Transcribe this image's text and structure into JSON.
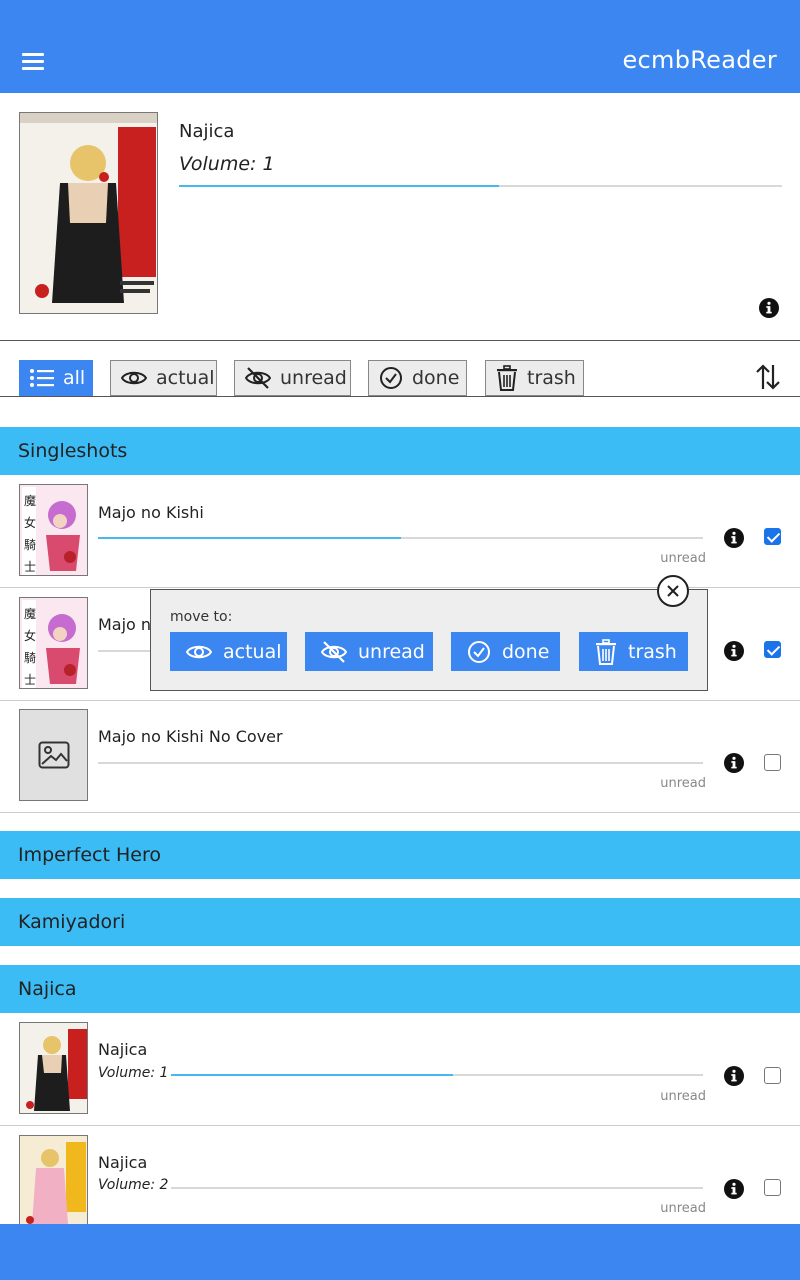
{
  "app": {
    "title": "ecmbReader"
  },
  "current_book": {
    "title": "Najica",
    "volume": "Volume: 1",
    "progress": 0.53
  },
  "filters": [
    {
      "label": "all",
      "icon": "list-icon",
      "active": true
    },
    {
      "label": "actual",
      "icon": "eye-icon",
      "active": false
    },
    {
      "label": "unread",
      "icon": "eye-slash-icon",
      "active": false
    },
    {
      "label": "done",
      "icon": "check-circle-icon",
      "active": false
    },
    {
      "label": "trash",
      "icon": "trash-icon",
      "active": false
    }
  ],
  "groups": [
    {
      "name": "Singleshots"
    },
    {
      "name": "Imperfect Hero"
    },
    {
      "name": "Kamiyadori"
    },
    {
      "name": "Najica"
    }
  ],
  "items": [
    {
      "title": "Majo no Kishi",
      "status": "unread",
      "progress": 0.5,
      "checked": true
    },
    {
      "title": "Majo no Kishi",
      "status": "unread",
      "progress": 0.0,
      "checked": true
    },
    {
      "title": "Majo no Kishi No Cover",
      "status": "unread",
      "progress": 0.0,
      "checked": false
    },
    {
      "title": "Najica",
      "volume": "Volume: 1",
      "status": "unread",
      "progress": 0.53,
      "checked": false
    },
    {
      "title": "Najica",
      "volume": "Volume: 2",
      "status": "unread",
      "progress": 0.0,
      "checked": false
    }
  ],
  "move_popup": {
    "label": "move to:",
    "buttons": [
      {
        "label": "actual",
        "icon": "eye-icon"
      },
      {
        "label": "unread",
        "icon": "eye-slash-icon"
      },
      {
        "label": "done",
        "icon": "check-circle-icon"
      },
      {
        "label": "trash",
        "icon": "trash-icon"
      }
    ]
  },
  "colors": {
    "appbar": "#3b86f0",
    "group_header": "#3cbcf5",
    "progress": "#46b7ef"
  }
}
